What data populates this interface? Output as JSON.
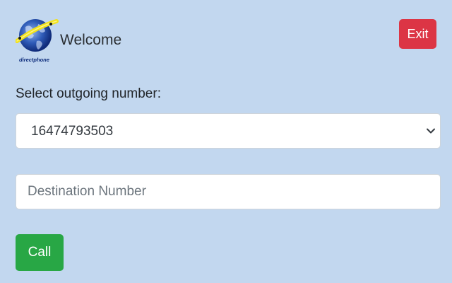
{
  "header": {
    "logo_text": "directphone",
    "welcome": "Welcome",
    "exit_label": "Exit"
  },
  "form": {
    "select_label": "Select outgoing number:",
    "selected_number": "16474793503",
    "destination_placeholder": "Destination Number",
    "destination_value": "",
    "call_label": "Call"
  },
  "icons": {
    "logo": "globe-logo-icon",
    "select_arrow": "chevron-down-icon"
  },
  "colors": {
    "background": "#c2d7ef",
    "exit_button": "#dc3545",
    "call_button": "#28a745"
  }
}
